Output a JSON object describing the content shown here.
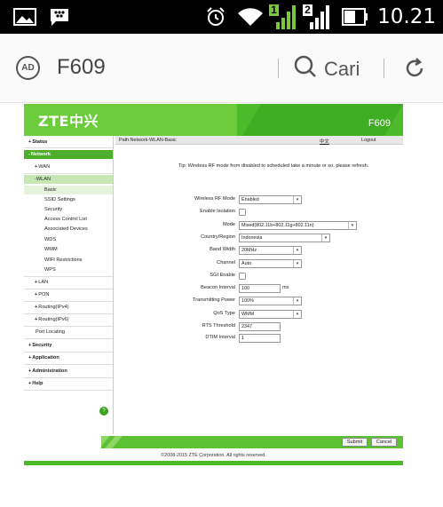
{
  "statusbar": {
    "time": "10.21",
    "sim1_label": "1",
    "sim2_label": "2",
    "icons": [
      "image-icon",
      "bbm-icon",
      "alarm-icon",
      "wifi-icon",
      "signal-sim1-icon",
      "signal-sim2-icon",
      "battery-icon"
    ]
  },
  "browser": {
    "url": "F609",
    "search_label": "Cari",
    "adblock_label": "AD"
  },
  "router": {
    "logo": "ZTE中兴",
    "product": "F609",
    "path": "Path:Network-WLAN-Basic",
    "language": "中文",
    "logout": "Logout",
    "sidebar": {
      "status": "Status",
      "network": "Network",
      "wan": "WAN",
      "wlan": "WLAN",
      "wlan_items": [
        "Basic",
        "SSID Settings",
        "Security",
        "Access Control List",
        "Associated Devices",
        "WDS",
        "WMM",
        "WIFI Restrictions",
        "WPS"
      ],
      "lan": "LAN",
      "pon": "PON",
      "routing_v4": "Routing(IPv4)",
      "routing_v6": "Routing(IPv6)",
      "port_locating": "Port Locating",
      "security": "Security",
      "application": "Application",
      "administration": "Administration",
      "help": "Help",
      "help_dot": "?"
    },
    "tip": "Tip: Wireless RF mode from disabled to scheduled take a minute or so, please refresh.",
    "form": {
      "rf_mode": {
        "label": "Wireless RF Mode",
        "value": "Enabled"
      },
      "isolation": {
        "label": "Enable Isolation"
      },
      "mode": {
        "label": "Mode",
        "value": "Mixed(802.11b+802.11g+802.11n)"
      },
      "country": {
        "label": "Country/Region",
        "value": "Indonesia"
      },
      "bandwidth": {
        "label": "Band Width",
        "value": "20MHz"
      },
      "channel": {
        "label": "Channel",
        "value": "Auto"
      },
      "sgi": {
        "label": "SGI Enable"
      },
      "beacon": {
        "label": "Beacon Interval",
        "value": "100",
        "unit": "ms"
      },
      "tx_power": {
        "label": "Transmitting Power",
        "value": "100%"
      },
      "qos": {
        "label": "QoS Type",
        "value": "WMM"
      },
      "rts": {
        "label": "RTS Threshold",
        "value": "2347"
      },
      "dtim": {
        "label": "DTIM Interval",
        "value": "1"
      }
    },
    "buttons": {
      "submit": "Submit",
      "cancel": "Cancel"
    },
    "copyright": "©2008-2015 ZTE Corporation. All rights reserved."
  }
}
